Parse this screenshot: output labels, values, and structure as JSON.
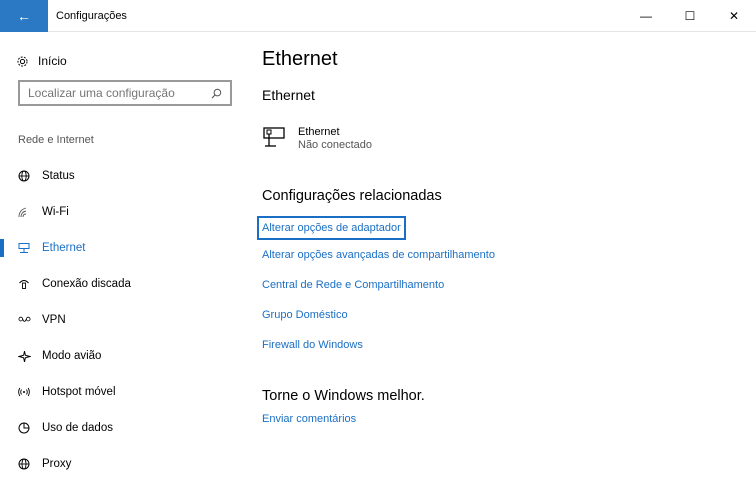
{
  "window": {
    "title": "Configurações",
    "back_icon": "←",
    "minimize": "—",
    "maximize": "☐",
    "close": "✕"
  },
  "sidebar": {
    "home_label": "Início",
    "search_placeholder": "Localizar uma configuração",
    "section_label": "Rede e Internet",
    "items": [
      {
        "label": "Status",
        "icon": "globe-icon"
      },
      {
        "label": "Wi-Fi",
        "icon": "wifi-icon"
      },
      {
        "label": "Ethernet",
        "icon": "ethernet-icon",
        "selected": true
      },
      {
        "label": "Conexão discada",
        "icon": "dialup-icon"
      },
      {
        "label": "VPN",
        "icon": "vpn-icon"
      },
      {
        "label": "Modo avião",
        "icon": "airplane-icon"
      },
      {
        "label": "Hotspot móvel",
        "icon": "hotspot-icon"
      },
      {
        "label": "Uso de dados",
        "icon": "data-usage-icon"
      },
      {
        "label": "Proxy",
        "icon": "proxy-icon"
      }
    ]
  },
  "main": {
    "title": "Ethernet",
    "subheading": "Ethernet",
    "device": {
      "name": "Ethernet",
      "status": "Não conectado"
    },
    "related_title": "Configurações relacionadas",
    "links": [
      "Alterar opções de adaptador",
      "Alterar opções avançadas de compartilhamento",
      "Central de Rede e Compartilhamento",
      "Grupo Doméstico",
      "Firewall do Windows"
    ],
    "improve_title": "Torne o Windows melhor.",
    "feedback_link": "Enviar comentários"
  },
  "colors": {
    "accent": "#1a6fc4",
    "titlebar_back": "#2b78c4"
  }
}
